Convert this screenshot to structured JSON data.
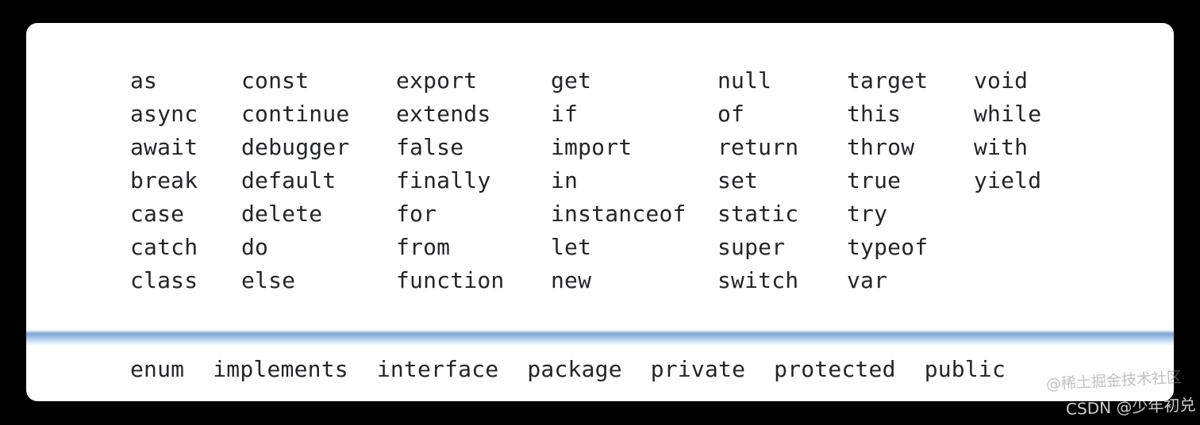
{
  "card": {
    "columns": [
      {
        "words": [
          "as",
          "async",
          "await",
          "break",
          "case",
          "catch",
          "class"
        ]
      },
      {
        "words": [
          "const",
          "continue",
          "debugger",
          "default",
          "delete",
          "do",
          "else"
        ]
      },
      {
        "words": [
          "export",
          "extends",
          "false",
          "finally",
          "for",
          "from",
          "function"
        ]
      },
      {
        "words": [
          "get",
          "if",
          "import",
          "in",
          "instanceof",
          "let",
          "new"
        ]
      },
      {
        "words": [
          "null",
          "of",
          "return",
          "set",
          "static",
          "super",
          "switch"
        ]
      },
      {
        "words": [
          "target",
          "this",
          "throw",
          "true",
          "try",
          "typeof",
          "var"
        ]
      },
      {
        "words": [
          "void",
          "while",
          "with",
          "yield"
        ]
      }
    ],
    "reserved_words": [
      "enum",
      "implements",
      "interface",
      "package",
      "private",
      "protected",
      "public"
    ],
    "separator_color": "#7ea9d8",
    "text_color": "#23252a",
    "background_color": "#ffffff"
  },
  "page": {
    "background_color": "#000000"
  },
  "watermarks": {
    "juejin": "@稀土掘金技术社区",
    "csdn": "CSDN @少年初兑"
  }
}
